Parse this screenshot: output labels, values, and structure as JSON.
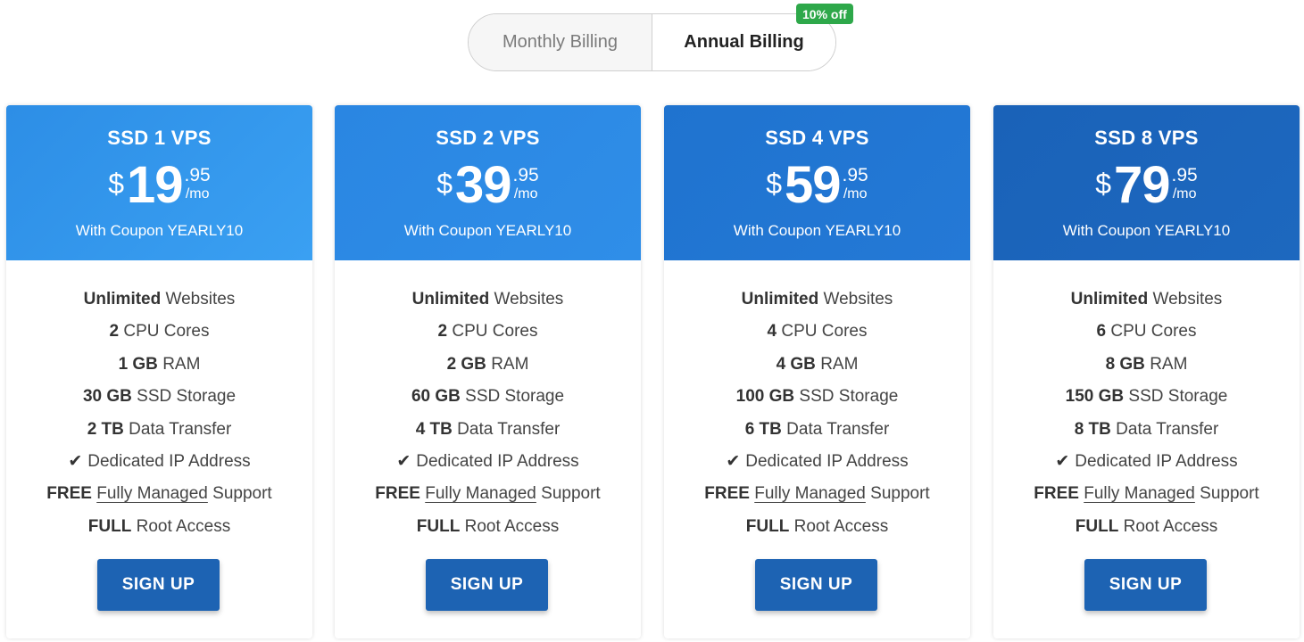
{
  "billing": {
    "monthly_label": "Monthly Billing",
    "annual_label": "Annual Billing",
    "selected": "Annual Billing",
    "badge": "10% off"
  },
  "plans": [
    {
      "name": "SSD 1 VPS",
      "currency": "$",
      "price_whole": "19",
      "price_cents": ".95",
      "per": "/mo",
      "coupon": "With Coupon YEARLY10",
      "features": {
        "websites_bold": "Unlimited",
        "websites_text": " Websites",
        "cpu_bold": "2",
        "cpu_text": " CPU Cores",
        "ram_bold": "1 GB",
        "ram_text": " RAM",
        "storage_bold": "30 GB",
        "storage_text": " SSD Storage",
        "transfer_bold": "2 TB",
        "transfer_text": " Data Transfer",
        "ip_text": "Dedicated IP Address",
        "support_bold": "FREE",
        "support_link": "Fully Managed",
        "support_text": " Support",
        "root_bold": "FULL",
        "root_text": " Root Access"
      },
      "button": "SIGN UP"
    },
    {
      "name": "SSD 2 VPS",
      "currency": "$",
      "price_whole": "39",
      "price_cents": ".95",
      "per": "/mo",
      "coupon": "With Coupon YEARLY10",
      "features": {
        "websites_bold": "Unlimited",
        "websites_text": " Websites",
        "cpu_bold": "2",
        "cpu_text": " CPU Cores",
        "ram_bold": "2 GB",
        "ram_text": " RAM",
        "storage_bold": "60 GB",
        "storage_text": " SSD Storage",
        "transfer_bold": "4 TB",
        "transfer_text": " Data Transfer",
        "ip_text": "Dedicated IP Address",
        "support_bold": "FREE",
        "support_link": "Fully Managed",
        "support_text": " Support",
        "root_bold": "FULL",
        "root_text": " Root Access"
      },
      "button": "SIGN UP"
    },
    {
      "name": "SSD 4 VPS",
      "currency": "$",
      "price_whole": "59",
      "price_cents": ".95",
      "per": "/mo",
      "coupon": "With Coupon YEARLY10",
      "features": {
        "websites_bold": "Unlimited",
        "websites_text": " Websites",
        "cpu_bold": "4",
        "cpu_text": " CPU Cores",
        "ram_bold": "4 GB",
        "ram_text": " RAM",
        "storage_bold": "100 GB",
        "storage_text": " SSD Storage",
        "transfer_bold": "6 TB",
        "transfer_text": " Data Transfer",
        "ip_text": "Dedicated IP Address",
        "support_bold": "FREE",
        "support_link": "Fully Managed",
        "support_text": " Support",
        "root_bold": "FULL",
        "root_text": " Root Access"
      },
      "button": "SIGN UP"
    },
    {
      "name": "SSD 8 VPS",
      "currency": "$",
      "price_whole": "79",
      "price_cents": ".95",
      "per": "/mo",
      "coupon": "With Coupon YEARLY10",
      "features": {
        "websites_bold": "Unlimited",
        "websites_text": " Websites",
        "cpu_bold": "6",
        "cpu_text": " CPU Cores",
        "ram_bold": "8 GB",
        "ram_text": " RAM",
        "storage_bold": "150 GB",
        "storage_text": " SSD Storage",
        "transfer_bold": "8 TB",
        "transfer_text": " Data Transfer",
        "ip_text": "Dedicated IP Address",
        "support_bold": "FREE",
        "support_link": "Fully Managed",
        "support_text": " Support",
        "root_bold": "FULL",
        "root_text": " Root Access"
      },
      "button": "SIGN UP"
    }
  ],
  "icons": {
    "feature_check": "check-icon"
  },
  "colors": {
    "badge_green": "#2ea84a",
    "button_blue": "#1d63b3",
    "header_blue_light": "#3aa0f2",
    "header_blue_dark": "#1a62b8"
  }
}
